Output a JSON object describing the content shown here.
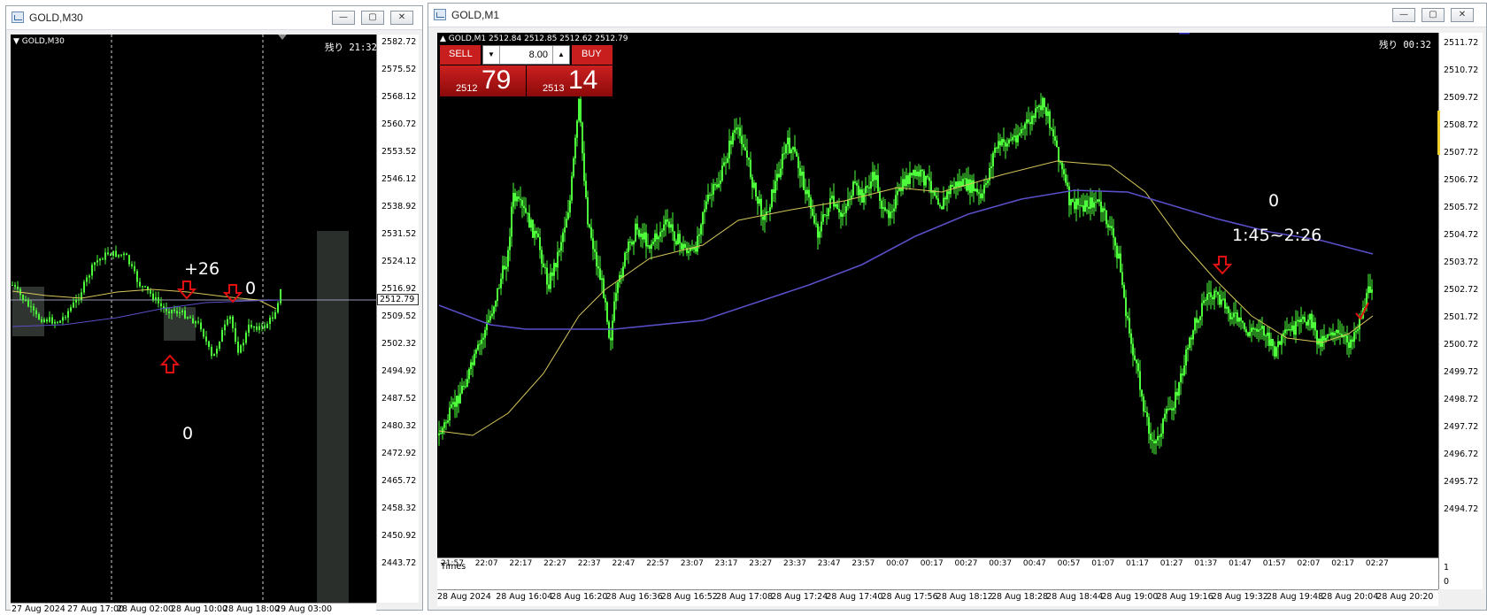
{
  "left_window": {
    "title": "GOLD,M30",
    "symbol_label": "GOLD,M30",
    "remaining_label": "残り 21:32",
    "current_price": "2512.79",
    "price_axis": [
      "2582.72",
      "2575.52",
      "2568.12",
      "2560.72",
      "2553.52",
      "2546.12",
      "2538.92",
      "2531.52",
      "2524.12",
      "2516.92",
      "2509.52",
      "2502.32",
      "2494.92",
      "2487.52",
      "2480.32",
      "2472.92",
      "2465.72",
      "2458.32",
      "2450.92",
      "2443.72"
    ],
    "time_axis": [
      "27 Aug 2024",
      "27 Aug 17:00",
      "28 Aug 02:00",
      "28 Aug 10:00",
      "28 Aug 18:00",
      "29 Aug 03:00"
    ],
    "annotations": {
      "plus": "+26",
      "zero_top": "0",
      "zero_bottom": "0"
    }
  },
  "right_window": {
    "title": "GOLD,M1",
    "symbol_label": "GOLD,M1  2512.84 2512.85 2512.62 2512.79",
    "remaining_label": "残り 00:32",
    "sell_label": "SELL",
    "buy_label": "BUY",
    "lot_value": "8.00",
    "sell_small": "2512",
    "sell_big": "79",
    "buy_small": "2513",
    "buy_big": "14",
    "price_axis": [
      "2511.72",
      "2510.72",
      "2509.72",
      "2508.72",
      "2507.72",
      "2506.72",
      "2505.72",
      "2504.72",
      "2503.72",
      "2502.72",
      "2501.72",
      "2500.72",
      "2499.72",
      "2498.72",
      "2497.72",
      "2496.72",
      "2495.72",
      "2494.72"
    ],
    "indicator_axis": [
      "1",
      "0"
    ],
    "indicator_label": "Times",
    "session_ticks": [
      "21:57",
      "22:07",
      "22:17",
      "22:27",
      "22:37",
      "22:47",
      "22:57",
      "23:07",
      "23:17",
      "23:27",
      "23:37",
      "23:47",
      "23:57",
      "00:07",
      "00:17",
      "00:27",
      "00:37",
      "00:47",
      "00:57",
      "01:07",
      "01:17",
      "01:27",
      "01:37",
      "01:47",
      "01:57",
      "02:07",
      "02:17",
      "02:27"
    ],
    "time_axis": [
      "28 Aug 2024",
      "28 Aug 16:04",
      "28 Aug 16:20",
      "28 Aug 16:36",
      "28 Aug 16:52",
      "28 Aug 17:08",
      "28 Aug 17:24",
      "28 Aug 17:40",
      "28 Aug 17:56",
      "28 Aug 18:12",
      "28 Aug 18:28",
      "28 Aug 18:44",
      "28 Aug 19:00",
      "28 Aug 19:16",
      "28 Aug 19:32",
      "28 Aug 19:48",
      "28 Aug 20:04",
      "28 Aug 20:20"
    ],
    "annotations": {
      "zero": "0",
      "range": "1:45~2:26"
    }
  },
  "colors": {
    "candle": "#4cff3a",
    "ma_fast": "#d8c85a",
    "ma_slow": "#5a4fc8",
    "arrow": "#e01010",
    "background": "#000000"
  }
}
